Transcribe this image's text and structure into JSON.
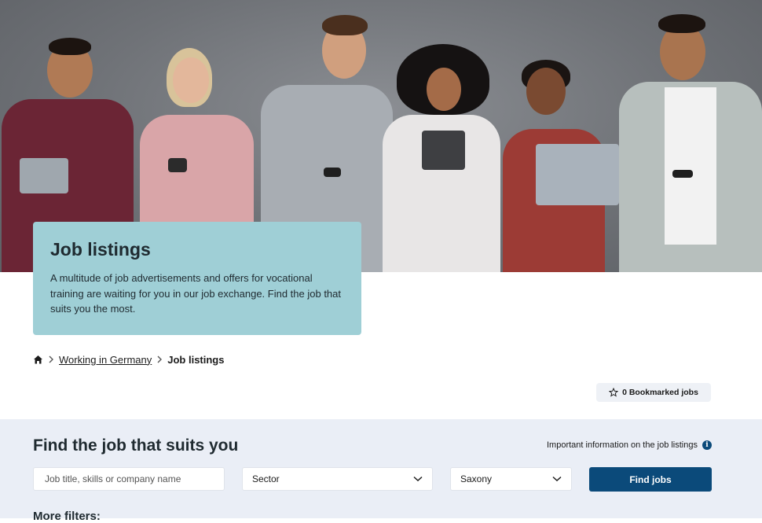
{
  "hero": {
    "image_alt": "Group of smiling young people holding tablets, phones and a laptop"
  },
  "intro": {
    "title": "Job listings",
    "description": "A multitude of job advertisements and offers for vocational training are waiting for you in our job exchange. Find the job that suits you the most."
  },
  "breadcrumb": {
    "home_icon": "home-icon",
    "items": [
      "Working in Germany",
      "Job listings"
    ]
  },
  "bookmarks": {
    "label": "0 Bookmarked jobs",
    "icon": "star-icon"
  },
  "search": {
    "title": "Find the job that suits you",
    "info_link": "Important information on the job listings",
    "keyword_placeholder": "Job title, skills or company name",
    "sector_value": "Sector",
    "region_value": "Saxony",
    "submit_label": "Find jobs",
    "more_filters": "More filters:"
  },
  "colors": {
    "card": "#9fcfd6",
    "panel": "#eaeef6",
    "primary": "#0b4a7a"
  }
}
